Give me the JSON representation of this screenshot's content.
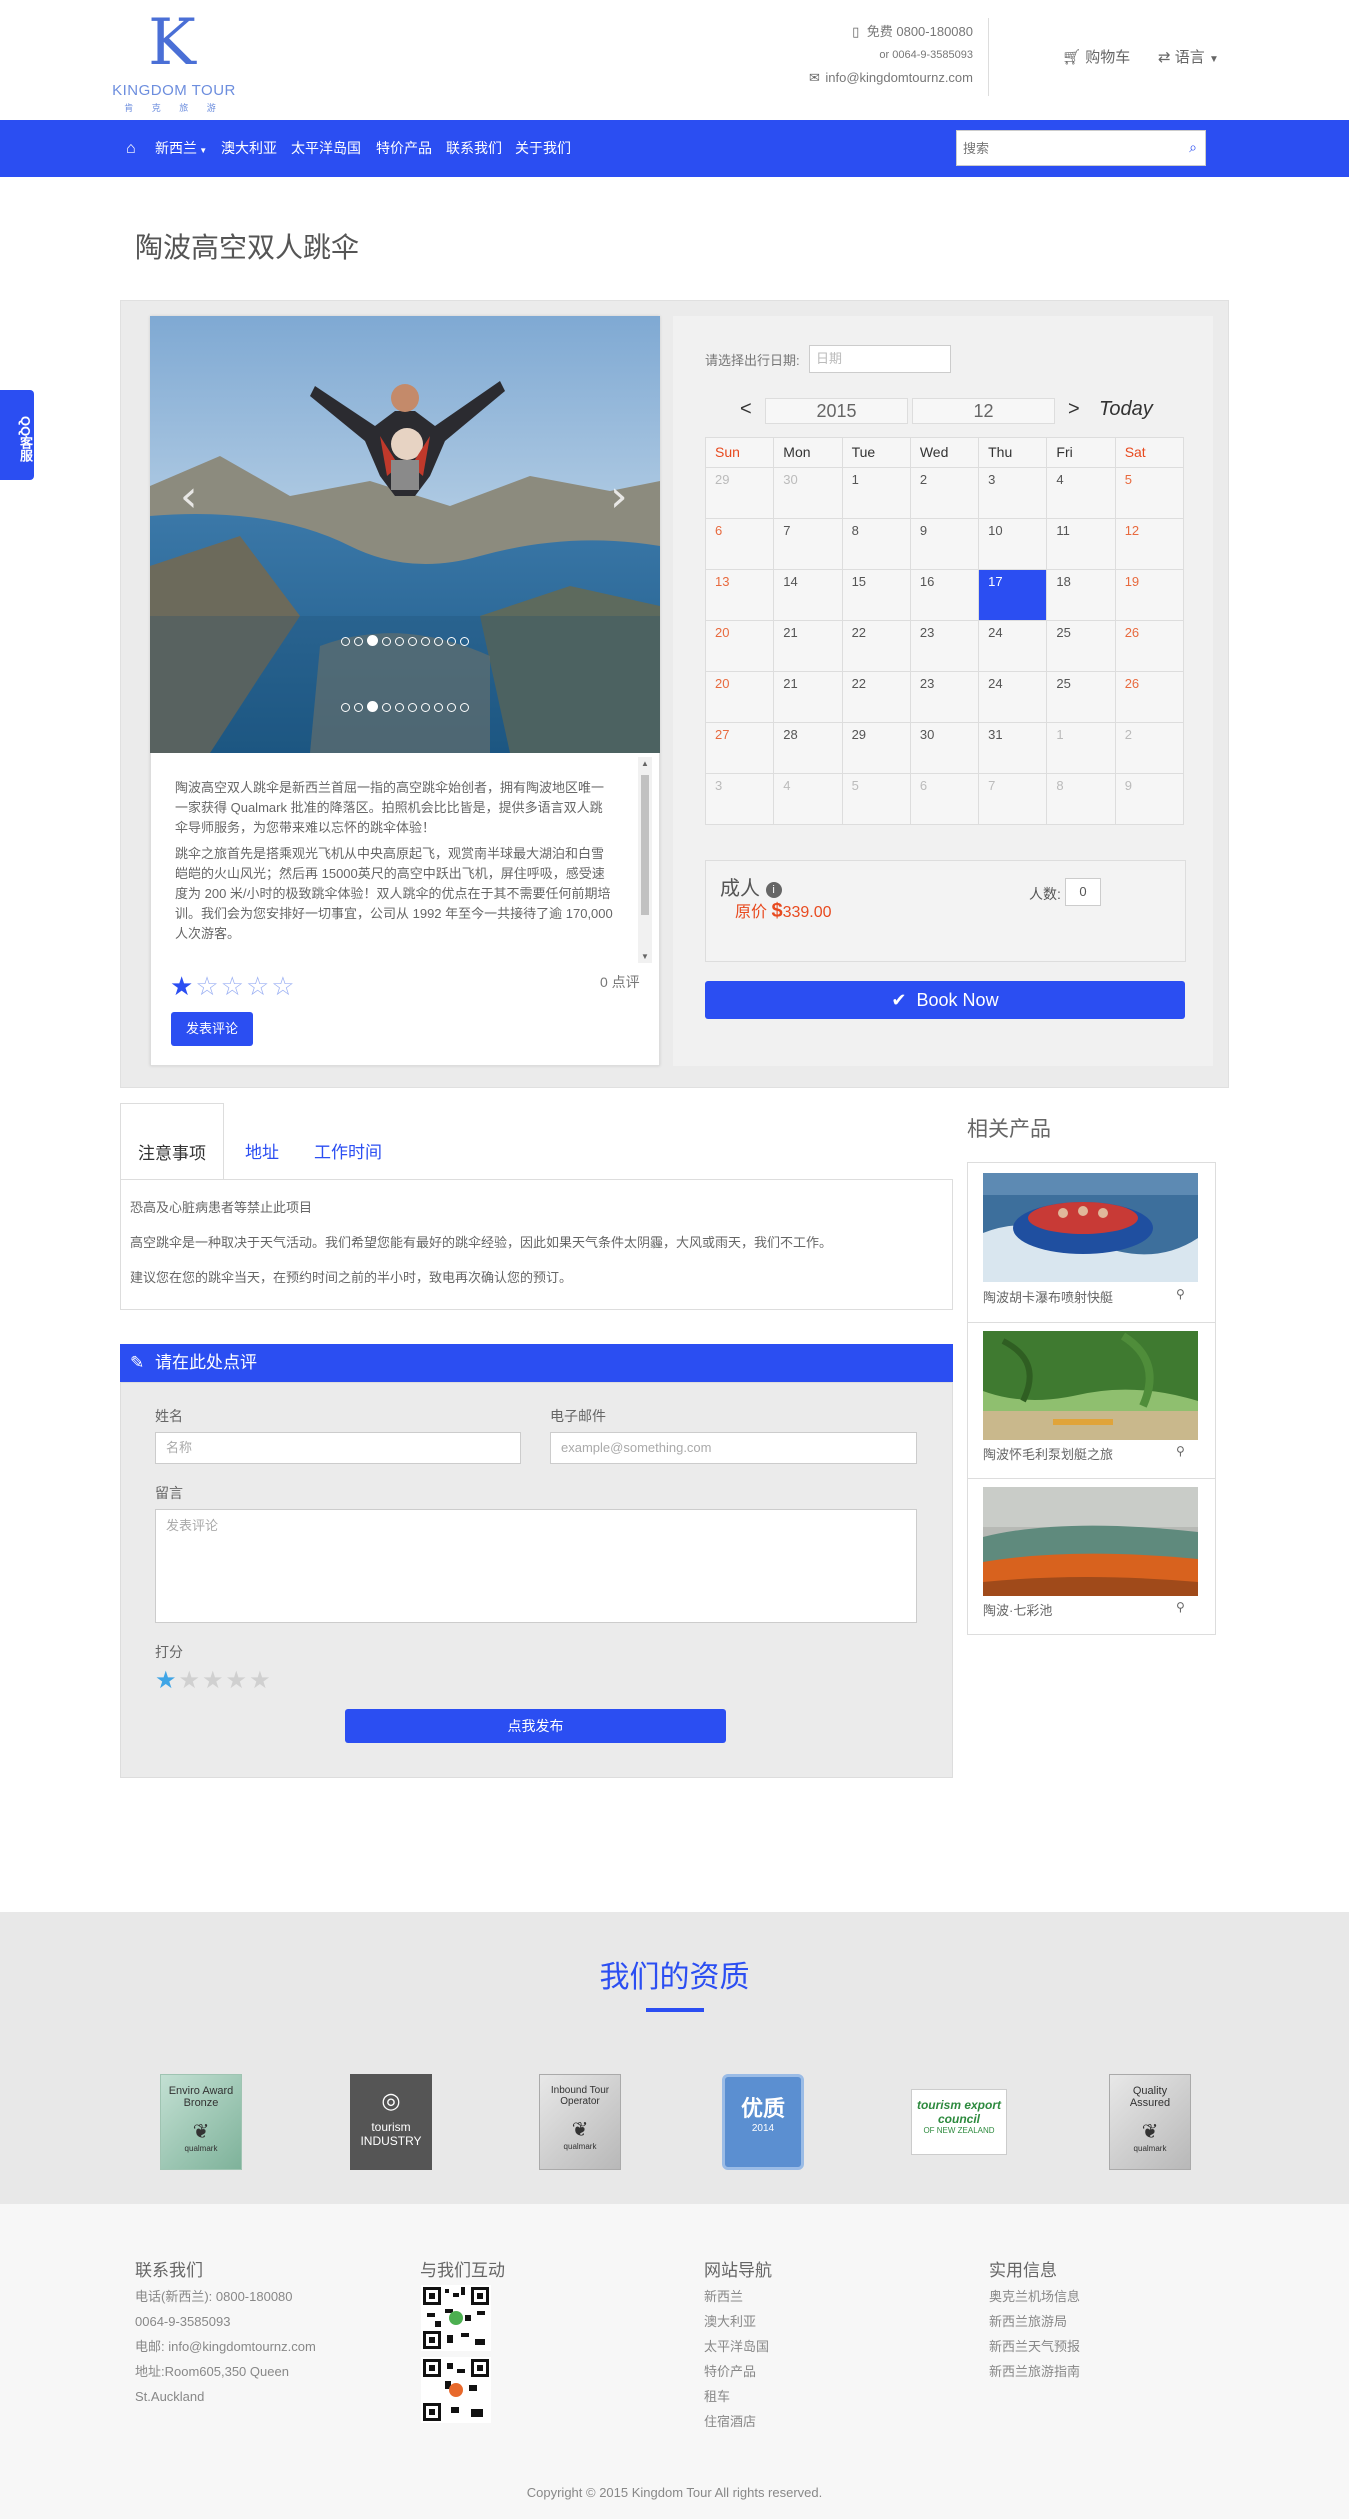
{
  "brand": {
    "name": "KINGDOM TOUR",
    "sub": "肯 克 旅 游",
    "logo_letter": "K"
  },
  "header": {
    "phone": "免费 0800-180080",
    "phone2": "or 0064-9-3585093",
    "email": "info@kingdomtournz.com",
    "cart": "购物车",
    "language": "语言"
  },
  "nav": {
    "items": [
      "新西兰",
      "澳大利亚",
      "太平洋岛国",
      "特价产品",
      "联系我们",
      "关于我们"
    ],
    "search_placeholder": "搜索"
  },
  "qq": "QQ客服",
  "product": {
    "title": "陶波高空双人跳伞",
    "description": [
      "陶波高空双人跳伞是新西兰首屈一指的高空跳伞始创者，拥有陶波地区唯一一家获得 Qualmark 批准的降落区。拍照机会比比皆是，提供多语言双人跳伞导师服务，为您带来难以忘怀的跳伞体验！",
      "跳伞之旅首先是搭乘观光飞机从中央高原起飞，观赏南半球最大湖泊和白雪皑皑的火山风光；然后再 15000英尺的高空中跃出飞机，屏住呼吸，感受速度为 200 米/小时的极致跳伞体验！双人跳伞的优点在于其不需要任何前期培训。我们会为您安排好一切事宜，公司从 1992 年至今一共接待了逾 170,000 人次游客。"
    ],
    "rating_count": "0 点评",
    "comment_button": "发表评论",
    "stars_filled": 1,
    "stars_total": 5
  },
  "booking": {
    "date_label": "请选择出行日期:",
    "date_placeholder": "日期",
    "year": "2015",
    "month": "12",
    "today": "Today",
    "weekdays": [
      "Sun",
      "Mon",
      "Tue",
      "Wed",
      "Thu",
      "Fri",
      "Sat"
    ],
    "rows": [
      [
        "29",
        "30",
        "1",
        "2",
        "3",
        "4",
        "5"
      ],
      [
        "6",
        "7",
        "8",
        "9",
        "10",
        "11",
        "12"
      ],
      [
        "13",
        "14",
        "15",
        "16",
        "17",
        "18",
        "19"
      ],
      [
        "20",
        "21",
        "22",
        "23",
        "24",
        "25",
        "26"
      ],
      [
        "20",
        "21",
        "22",
        "23",
        "24",
        "25",
        "26"
      ],
      [
        "27",
        "28",
        "29",
        "30",
        "31",
        "1",
        "2"
      ],
      [
        "3",
        "4",
        "5",
        "6",
        "7",
        "8",
        "9"
      ]
    ],
    "adult_label": "成人",
    "price_label": "原价",
    "price": "339.00",
    "people_label": "人数:",
    "people_value": "0",
    "book_button": "Book Now"
  },
  "tabs": {
    "items": [
      "注意事项",
      "地址",
      "工作时间"
    ],
    "lines": [
      "恐高及心脏病患者等禁止此项目",
      "高空跳伞是一种取决于天气活动。我们希望您能有最好的跳伞经验，因此如果天气条件太阴霾，大风或雨天，我们不工作。",
      "建议您在您的跳伞当天，在预约时间之前的半小时，致电再次确认您的预订。"
    ]
  },
  "review": {
    "title": "请在此处点评",
    "name_label": "姓名",
    "name_placeholder": "名称",
    "email_label": "电子邮件",
    "email_placeholder": "example@something.com",
    "message_label": "留言",
    "message_placeholder": "发表评论",
    "rating_label": "打分",
    "submit": "点我发布"
  },
  "related": {
    "title": "相关产品",
    "items": [
      {
        "name": "陶波胡卡瀑布喷射快艇"
      },
      {
        "name": "陶波怀毛利泵划艇之旅"
      },
      {
        "name": "陶波·七彩池"
      }
    ]
  },
  "qualifications": {
    "title": "我们的资质",
    "badges": [
      {
        "name": "Enviro Award Bronze",
        "sub": "qualmark"
      },
      {
        "name": "tourism INDUSTRY",
        "sub": ""
      },
      {
        "name": "Inbound Tour Operator",
        "sub": "qualmark"
      },
      {
        "name": "优质",
        "sub": "2014"
      },
      {
        "name": "tourism export council",
        "sub": "OF NEW ZEALAND"
      },
      {
        "name": "Quality Assured",
        "sub": "qualmark"
      }
    ]
  },
  "footer": {
    "contact_title": "联系我们",
    "contact_lines": [
      "电话(新西兰): 0800-180080",
      "0064-9-3585093",
      "电邮: info@kingdomtournz.com",
      "地址:Room605,350 Queen",
      "St.Auckland"
    ],
    "interact_title": "与我们互动",
    "nav_title": "网站导航",
    "nav_links": [
      "新西兰",
      "澳大利亚",
      "太平洋岛国",
      "特价产品",
      "租车",
      "住宿酒店"
    ],
    "info_title": "实用信息",
    "info_links": [
      "奥克兰机场信息",
      "新西兰旅游局",
      "新西兰天气预报",
      "新西兰旅游指南"
    ],
    "copyright": "Copyright © 2015 Kingdom Tour All rights reserved."
  },
  "colors": {
    "accent": "#2b4ef2",
    "sale": "#e84a1f",
    "footer_bg": "#f7f7f7",
    "band_bg": "#e8e8e8"
  }
}
